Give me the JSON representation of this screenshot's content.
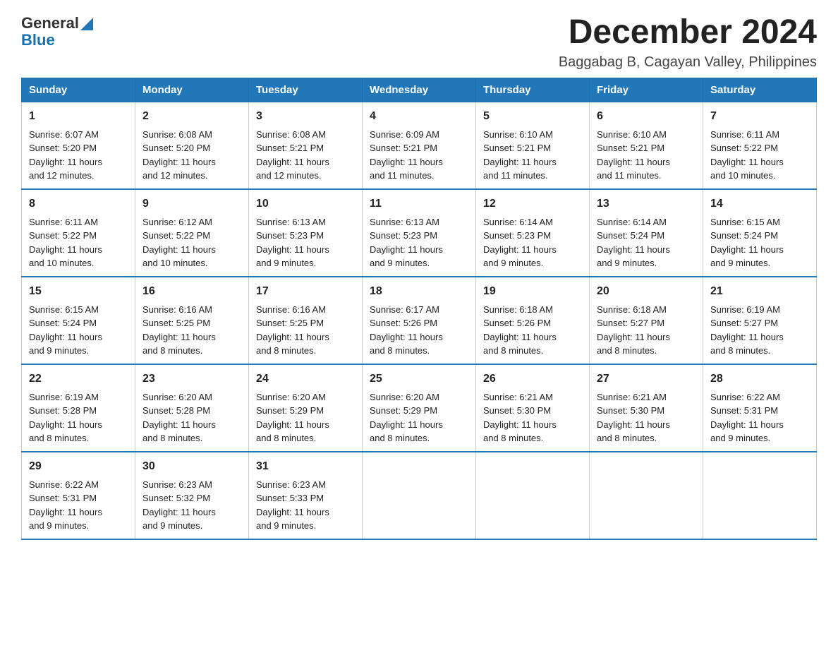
{
  "header": {
    "logo_general": "General",
    "logo_blue": "Blue",
    "month_title": "December 2024",
    "location": "Baggabag B, Cagayan Valley, Philippines"
  },
  "days_of_week": [
    "Sunday",
    "Monday",
    "Tuesday",
    "Wednesday",
    "Thursday",
    "Friday",
    "Saturday"
  ],
  "weeks": [
    [
      {
        "day": "1",
        "sunrise": "6:07 AM",
        "sunset": "5:20 PM",
        "daylight": "11 hours and 12 minutes."
      },
      {
        "day": "2",
        "sunrise": "6:08 AM",
        "sunset": "5:20 PM",
        "daylight": "11 hours and 12 minutes."
      },
      {
        "day": "3",
        "sunrise": "6:08 AM",
        "sunset": "5:21 PM",
        "daylight": "11 hours and 12 minutes."
      },
      {
        "day": "4",
        "sunrise": "6:09 AM",
        "sunset": "5:21 PM",
        "daylight": "11 hours and 11 minutes."
      },
      {
        "day": "5",
        "sunrise": "6:10 AM",
        "sunset": "5:21 PM",
        "daylight": "11 hours and 11 minutes."
      },
      {
        "day": "6",
        "sunrise": "6:10 AM",
        "sunset": "5:21 PM",
        "daylight": "11 hours and 11 minutes."
      },
      {
        "day": "7",
        "sunrise": "6:11 AM",
        "sunset": "5:22 PM",
        "daylight": "11 hours and 10 minutes."
      }
    ],
    [
      {
        "day": "8",
        "sunrise": "6:11 AM",
        "sunset": "5:22 PM",
        "daylight": "11 hours and 10 minutes."
      },
      {
        "day": "9",
        "sunrise": "6:12 AM",
        "sunset": "5:22 PM",
        "daylight": "11 hours and 10 minutes."
      },
      {
        "day": "10",
        "sunrise": "6:13 AM",
        "sunset": "5:23 PM",
        "daylight": "11 hours and 9 minutes."
      },
      {
        "day": "11",
        "sunrise": "6:13 AM",
        "sunset": "5:23 PM",
        "daylight": "11 hours and 9 minutes."
      },
      {
        "day": "12",
        "sunrise": "6:14 AM",
        "sunset": "5:23 PM",
        "daylight": "11 hours and 9 minutes."
      },
      {
        "day": "13",
        "sunrise": "6:14 AM",
        "sunset": "5:24 PM",
        "daylight": "11 hours and 9 minutes."
      },
      {
        "day": "14",
        "sunrise": "6:15 AM",
        "sunset": "5:24 PM",
        "daylight": "11 hours and 9 minutes."
      }
    ],
    [
      {
        "day": "15",
        "sunrise": "6:15 AM",
        "sunset": "5:24 PM",
        "daylight": "11 hours and 9 minutes."
      },
      {
        "day": "16",
        "sunrise": "6:16 AM",
        "sunset": "5:25 PM",
        "daylight": "11 hours and 8 minutes."
      },
      {
        "day": "17",
        "sunrise": "6:16 AM",
        "sunset": "5:25 PM",
        "daylight": "11 hours and 8 minutes."
      },
      {
        "day": "18",
        "sunrise": "6:17 AM",
        "sunset": "5:26 PM",
        "daylight": "11 hours and 8 minutes."
      },
      {
        "day": "19",
        "sunrise": "6:18 AM",
        "sunset": "5:26 PM",
        "daylight": "11 hours and 8 minutes."
      },
      {
        "day": "20",
        "sunrise": "6:18 AM",
        "sunset": "5:27 PM",
        "daylight": "11 hours and 8 minutes."
      },
      {
        "day": "21",
        "sunrise": "6:19 AM",
        "sunset": "5:27 PM",
        "daylight": "11 hours and 8 minutes."
      }
    ],
    [
      {
        "day": "22",
        "sunrise": "6:19 AM",
        "sunset": "5:28 PM",
        "daylight": "11 hours and 8 minutes."
      },
      {
        "day": "23",
        "sunrise": "6:20 AM",
        "sunset": "5:28 PM",
        "daylight": "11 hours and 8 minutes."
      },
      {
        "day": "24",
        "sunrise": "6:20 AM",
        "sunset": "5:29 PM",
        "daylight": "11 hours and 8 minutes."
      },
      {
        "day": "25",
        "sunrise": "6:20 AM",
        "sunset": "5:29 PM",
        "daylight": "11 hours and 8 minutes."
      },
      {
        "day": "26",
        "sunrise": "6:21 AM",
        "sunset": "5:30 PM",
        "daylight": "11 hours and 8 minutes."
      },
      {
        "day": "27",
        "sunrise": "6:21 AM",
        "sunset": "5:30 PM",
        "daylight": "11 hours and 8 minutes."
      },
      {
        "day": "28",
        "sunrise": "6:22 AM",
        "sunset": "5:31 PM",
        "daylight": "11 hours and 9 minutes."
      }
    ],
    [
      {
        "day": "29",
        "sunrise": "6:22 AM",
        "sunset": "5:31 PM",
        "daylight": "11 hours and 9 minutes."
      },
      {
        "day": "30",
        "sunrise": "6:23 AM",
        "sunset": "5:32 PM",
        "daylight": "11 hours and 9 minutes."
      },
      {
        "day": "31",
        "sunrise": "6:23 AM",
        "sunset": "5:33 PM",
        "daylight": "11 hours and 9 minutes."
      },
      null,
      null,
      null,
      null
    ]
  ],
  "labels": {
    "sunrise": "Sunrise:",
    "sunset": "Sunset:",
    "daylight": "Daylight:"
  }
}
